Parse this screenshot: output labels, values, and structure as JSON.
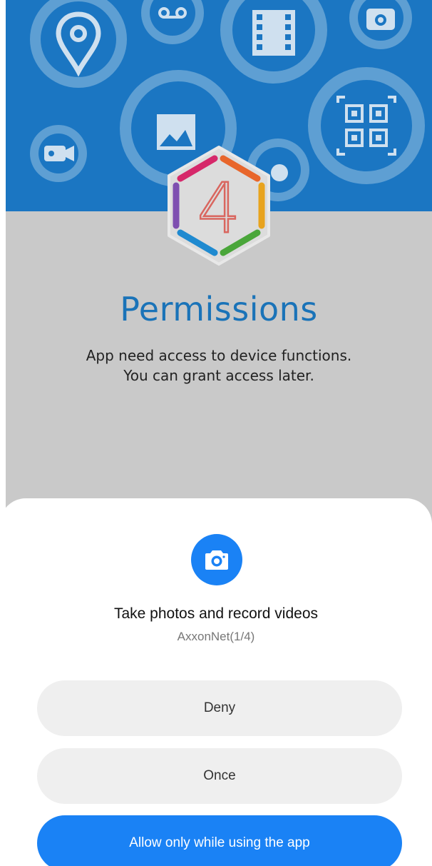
{
  "background": {
    "hero_color": "#1b76c2",
    "page_color": "#c9c9c9",
    "decor_icons": [
      "location-pin-icon",
      "voicemail-icon",
      "film-icon",
      "camera-icon",
      "image-icon",
      "video-camera-icon",
      "qr-code-icon",
      "cloud-icon"
    ]
  },
  "logo": {
    "number": "4",
    "icon": "hexagon-logo-icon"
  },
  "page": {
    "title": "Permissions",
    "subtitle_line1": "App need access to device functions.",
    "subtitle_line2": "You can grant access later."
  },
  "dialog": {
    "icon": "camera-icon",
    "accent": "#1a82f5",
    "title": "Take photos and record videos",
    "app_label": "AxxonNet(1/4)",
    "buttons": {
      "deny": "Deny",
      "once": "Once",
      "allow": "Allow only while using the app"
    }
  }
}
